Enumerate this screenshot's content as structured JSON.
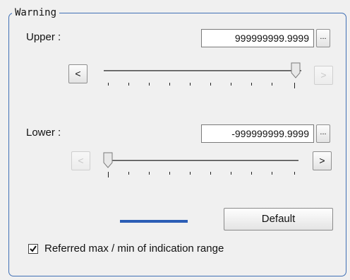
{
  "group": {
    "title": "Warning"
  },
  "upper": {
    "label": "Upper :",
    "value": "999999999.9999",
    "browse_label": "...",
    "dec_label": "<",
    "inc_label": ">",
    "slider_position": 1.0
  },
  "lower": {
    "label": "Lower :",
    "value": "-999999999.9999",
    "browse_label": "...",
    "dec_label": "<",
    "inc_label": ">",
    "slider_position": 0.0
  },
  "color_indicator": "#2b5db5",
  "default_button": "Default",
  "referred_checkbox": {
    "label": "Referred max / min of indication range",
    "checked": true
  }
}
